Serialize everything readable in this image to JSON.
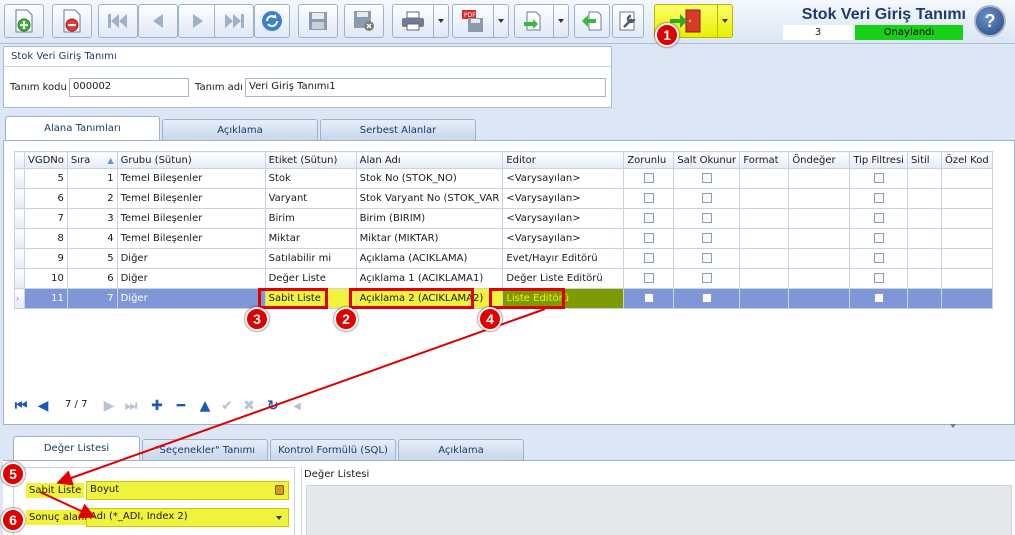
{
  "toolbar": {
    "buttons": [
      "new-record",
      "delete-record",
      "first",
      "previous",
      "next",
      "last",
      "refresh",
      "save",
      "save-close",
      "print",
      "pdf-export",
      "import",
      "back",
      "tools",
      "exit"
    ],
    "exit_color": "#e6ef00"
  },
  "header": {
    "title": "Stok Veri Giriş Tanımı",
    "record_no": "3",
    "status": "Onaylandı",
    "status_color": "#17d017"
  },
  "form_group": {
    "title": "Stok Veri Giriş Tanımı",
    "code_label": "Tanım kodu",
    "code_value": "000002",
    "name_label": "Tanım adı",
    "name_value": "Veri Giriş Tanımı1"
  },
  "top_tabs": [
    "Alana Tanımları",
    "Açıklama",
    "Serbest Alanlar"
  ],
  "grid": {
    "columns": [
      "VGDNo",
      "Sıra",
      "Grubu (Sütun)",
      "Etiket (Sütun)",
      "Alan Adı",
      "Editor",
      "Zorunlu",
      "Salt Okunur",
      "Format",
      "Öndeğer",
      "Tip Filtresi",
      "Sitil",
      "Özel Kod"
    ],
    "rows": [
      {
        "vgdno": "5",
        "sira": "1",
        "grubu": "Temel Bileşenler",
        "etiket": "Stok",
        "alan": "Stok No (STOK_NO)",
        "editor": "<Varysayılan>"
      },
      {
        "vgdno": "6",
        "sira": "2",
        "grubu": "Temel Bileşenler",
        "etiket": "Varyant",
        "alan": "Stok Varyant No (STOK_VAR",
        "editor": "<Varysayılan>"
      },
      {
        "vgdno": "7",
        "sira": "3",
        "grubu": "Temel Bileşenler",
        "etiket": "Birim",
        "alan": "Birim (BIRIM)",
        "editor": "<Varysayılan>"
      },
      {
        "vgdno": "8",
        "sira": "4",
        "grubu": "Temel Bileşenler",
        "etiket": "Miktar",
        "alan": "Miktar (MIKTAR)",
        "editor": "<Varysayılan>"
      },
      {
        "vgdno": "9",
        "sira": "5",
        "grubu": "Diğer",
        "etiket": "Satılabilir mi",
        "alan": "Açıklama (ACIKLAMA)",
        "editor": "Evet/Hayır Editörü"
      },
      {
        "vgdno": "10",
        "sira": "6",
        "grubu": "Diğer",
        "etiket": "Değer Liste",
        "alan": "Açıklama 1 (ACIKLAMA1)",
        "editor": "Değer Liste Editörü"
      },
      {
        "vgdno": "11",
        "sira": "7",
        "grubu": "Diğer",
        "etiket": "Sabit Liste",
        "alan": "Açıklama 2 (ACIKLAMA2)",
        "editor": "Liste Editörü"
      }
    ],
    "selected_row": 6,
    "selection_color": "#7f97d6",
    "highlight_color": "#f0f23c"
  },
  "navigator": {
    "position": "7 / 7"
  },
  "bottom_tabs": [
    "Değer Listesi",
    "\"Seçenekler\" Tanımı",
    "Kontrol Formülü (SQL)",
    "Açıklama"
  ],
  "detail": {
    "fixed_list_label": "Sabit Liste",
    "fixed_list_value": "Boyut",
    "result_field_label": "Sonuç alanı",
    "result_field_value": "Adı (*_ADI, Index 2)",
    "value_list_title": "Değer Listesi"
  },
  "markers": [
    "1",
    "2",
    "3",
    "4",
    "5",
    "6"
  ],
  "annotation_color": "#e00000"
}
